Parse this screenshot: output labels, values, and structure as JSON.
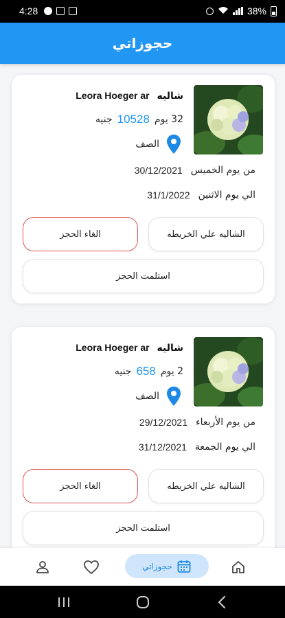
{
  "status_bar": {
    "time": "4:28",
    "battery": "38%"
  },
  "header": {
    "title": "حجوزاتي"
  },
  "bookings": [
    {
      "title_prefix": "شاليه",
      "title_name": "Leora Hoeger ar",
      "duration": "32 يوم",
      "price": "10528",
      "currency": "جنيه",
      "location": "الصف",
      "from_label": "من يوم الخميس",
      "from_date": "30/12/2021",
      "to_label": "الي يوم الاثنين",
      "to_date": "31/1/2022",
      "map_button": "الشاليه علي الخريطه",
      "cancel_button": "الغاء الحجز",
      "receive_button": "استلمت الحجز"
    },
    {
      "title_prefix": "شاليه",
      "title_name": "Leora Hoeger ar",
      "duration": "2 يوم",
      "price": "658",
      "currency": "جنيه",
      "location": "الصف",
      "from_label": "من يوم الأربعاء",
      "from_date": "29/12/2021",
      "to_label": "الي يوم الجمعة",
      "to_date": "31/12/2021",
      "map_button": "الشاليه علي الخريطه",
      "cancel_button": "الغاء الحجز",
      "receive_button": "استلمت الحجز"
    }
  ],
  "bottom_nav": {
    "home_icon": "home-icon",
    "bookings_label": "حجوزاتي",
    "bookings_icon": "calendar-icon",
    "favorites_icon": "heart-icon",
    "profile_icon": "person-icon",
    "active_color": "#1e88e5"
  },
  "colors": {
    "primary": "#2196f3",
    "cancel_border": "#d9534f",
    "active_pill": "#cfe5fb"
  }
}
